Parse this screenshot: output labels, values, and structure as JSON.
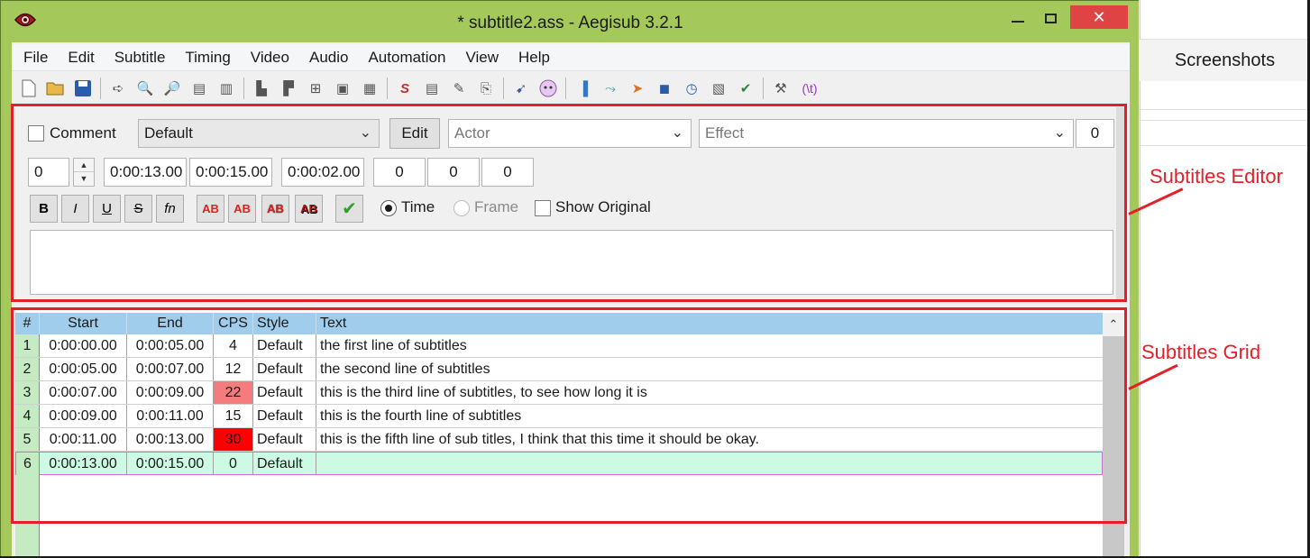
{
  "window": {
    "title": "* subtitle2.ass - Aegisub 3.2.1"
  },
  "menu": [
    "File",
    "Edit",
    "Subtitle",
    "Timing",
    "Video",
    "Audio",
    "Automation",
    "View",
    "Help"
  ],
  "toolbar": {
    "icons": [
      "new-file-icon",
      "open-file-icon",
      "save-icon",
      "sep",
      "jump-to-icon",
      "zoom-in-icon",
      "zoom-out-icon",
      "snapshot-icon",
      "snapshot-copy-icon",
      "sep",
      "styles-manager-icon",
      "styles-storage-icon",
      "attachments-icon",
      "fonts-collector-icon",
      "properties-icon",
      "sep",
      "automation-icon",
      "resample-icon",
      "find-icon",
      "replace-icon",
      "sep",
      "script-icon",
      "kanji-timer-icon",
      "sep",
      "shift-times-icon",
      "timing-postprocessor-icon",
      "fish-icon",
      "square-icon",
      "timer-icon",
      "translation-assistant-icon",
      "spell-check-icon",
      "sep",
      "options-icon",
      "tag-icon"
    ],
    "tag_label": "(\\t)"
  },
  "editor": {
    "comment_label": "Comment",
    "style_value": "Default",
    "edit_button": "Edit",
    "actor_placeholder": "Actor",
    "effect_placeholder": "Effect",
    "margin_top": "0",
    "layer": "0",
    "start_time": "0:00:13.00",
    "end_time": "0:00:15.00",
    "duration": "0:00:02.00",
    "margin_l": "0",
    "margin_r": "0",
    "margin_v": "0",
    "format_buttons": {
      "bold": "B",
      "italic": "I",
      "underline": "U",
      "strike": "S",
      "font": "fn",
      "color1": "AB",
      "color2": "AB",
      "color3": "AB",
      "color4": "AB"
    },
    "time_label": "Time",
    "frame_label": "Frame",
    "show_original_label": "Show Original",
    "text_value": ""
  },
  "grid": {
    "headers": [
      "#",
      "Start",
      "End",
      "CPS",
      "Style",
      "Text"
    ],
    "rows": [
      {
        "num": "1",
        "start": "0:00:00.00",
        "end": "0:00:05.00",
        "cps": "4",
        "style": "Default",
        "text": "the first line of subtitles",
        "cps_color": ""
      },
      {
        "num": "2",
        "start": "0:00:05.00",
        "end": "0:00:07.00",
        "cps": "12",
        "style": "Default",
        "text": "the second line of subtitles",
        "cps_color": ""
      },
      {
        "num": "3",
        "start": "0:00:07.00",
        "end": "0:00:09.00",
        "cps": "22",
        "style": "Default",
        "text": "this is the third line of subtitles, to see how long it is",
        "cps_color": "#f47c7c"
      },
      {
        "num": "4",
        "start": "0:00:09.00",
        "end": "0:00:11.00",
        "cps": "15",
        "style": "Default",
        "text": "this is the fourth line of subtitles",
        "cps_color": ""
      },
      {
        "num": "5",
        "start": "0:00:11.00",
        "end": "0:00:13.00",
        "cps": "30",
        "style": "Default",
        "text": "this is the fifth line of sub titles, I think that this time it should be okay.",
        "cps_color": "#ff0000"
      },
      {
        "num": "6",
        "start": "0:00:13.00",
        "end": "0:00:15.00",
        "cps": "0",
        "style": "Default",
        "text": "",
        "cps_color": ""
      }
    ],
    "active_row": 5
  },
  "annotations": {
    "editor_label": "Subtitles Editor",
    "grid_label": "Subtitles Grid"
  },
  "side_panel": {
    "title": "Screenshots"
  },
  "colors": {
    "window_frame": "#a5c85a",
    "close_button": "#e04343",
    "grid_header": "#9fcdeb",
    "row_number": "#c4ebc2",
    "active_row": "#ccfae2",
    "annotation": "#e3202a"
  }
}
